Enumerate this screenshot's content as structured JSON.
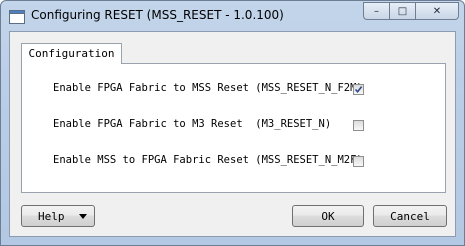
{
  "window": {
    "title": "Configuring RESET (MSS_RESET - 1.0.100)",
    "caption_minimize": "–",
    "caption_maximize": "□",
    "caption_close": "✕"
  },
  "tabs": [
    {
      "label": "Configuration",
      "selected": true
    }
  ],
  "options": [
    {
      "label": "Enable FPGA Fabric to MSS Reset (MSS_RESET_N_F2M)",
      "checked": true
    },
    {
      "label": "Enable FPGA Fabric to M3 Reset  (M3_RESET_N)",
      "checked": false
    },
    {
      "label": "Enable MSS to FPGA Fabric Reset (MSS_RESET_N_M2F)",
      "checked": false
    }
  ],
  "buttons": {
    "help": "Help",
    "ok": "OK",
    "cancel": "Cancel"
  },
  "colors": {
    "titlebar": "#b9cde6",
    "dialog_background": "#f0f0f0",
    "checkmark": "#2c4a8a"
  }
}
